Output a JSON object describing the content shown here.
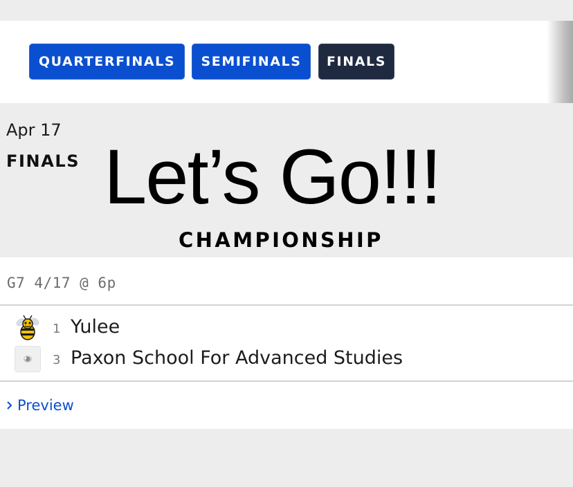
{
  "tabs": [
    {
      "label": "QUARTERFINALS",
      "active": false
    },
    {
      "label": "SEMIFINALS",
      "active": false
    },
    {
      "label": "FINALS",
      "active": true
    }
  ],
  "section": {
    "date": "Apr 17",
    "round": "FINALS",
    "headline": "Let’s Go!!!",
    "subtitle": "CHAMPIONSHIP"
  },
  "game": {
    "meta": "G7 4/17 @ 6p",
    "teams": [
      {
        "seed": "1",
        "name": "Yulee",
        "logo": "yellow-jacket-icon"
      },
      {
        "seed": "3",
        "name": "Paxon School For Advanced Studies",
        "logo": "school-logo-icon"
      }
    ],
    "preview_label": "Preview"
  },
  "colors": {
    "accent_blue": "#0a4fd0",
    "active_tab": "#1f2940",
    "page_background": "#ededed"
  }
}
